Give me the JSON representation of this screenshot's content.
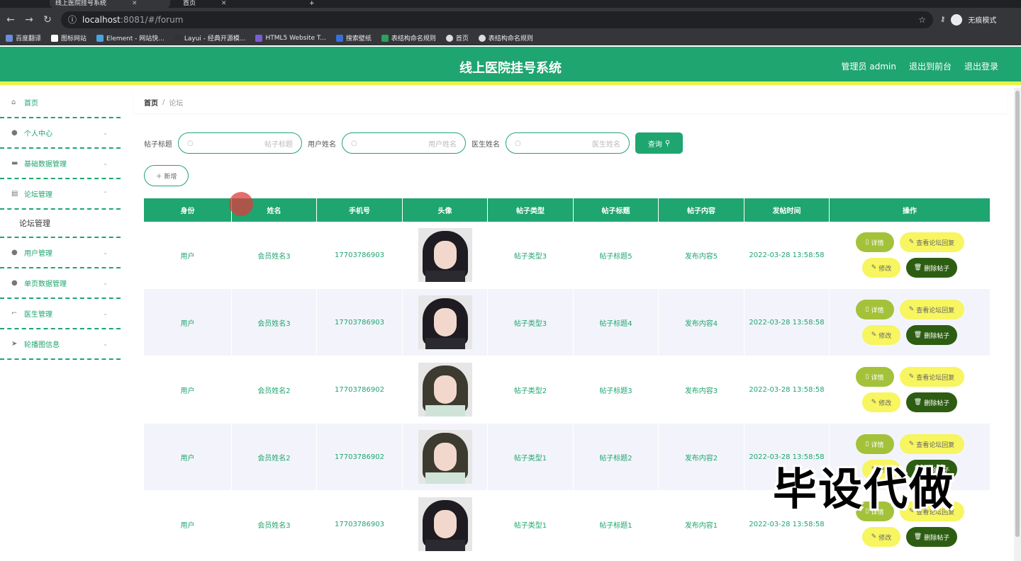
{
  "browser": {
    "tabs": [
      "线上医院挂号系统",
      "首页"
    ],
    "url_host": "localhost",
    "url_rest": ":8081/#/forum",
    "profile_label": "无痕模式",
    "bookmarks": [
      "百度翻译",
      "图标网站",
      "Element - 网站快...",
      "Layui - 经典开源模...",
      "HTML5 Website T...",
      "搜索壁纸",
      "表结构命名规则",
      "首页",
      "表结构命名规则"
    ]
  },
  "header": {
    "title": "线上医院挂号系统",
    "admin_label": "管理员 admin",
    "front_label": "退出到前台",
    "logout_label": "退出登录"
  },
  "sidebar": {
    "items": [
      {
        "label": "首页",
        "icon": "home-icon"
      },
      {
        "label": "个人中心",
        "icon": "user-icon"
      },
      {
        "label": "基础数据管理",
        "icon": "ticket-icon"
      },
      {
        "label": "论坛管理",
        "icon": "clipboard-icon"
      },
      {
        "label": "论坛管理",
        "icon": ""
      },
      {
        "label": "用户管理",
        "icon": "user-icon"
      },
      {
        "label": "单页数据管理",
        "icon": "bulb-icon"
      },
      {
        "label": "医生管理",
        "icon": "crop-icon"
      },
      {
        "label": "轮播图信息",
        "icon": "send-icon"
      }
    ]
  },
  "breadcrumb": {
    "home": "首页",
    "sep": "/",
    "current": "论坛"
  },
  "search": {
    "title_label": "帖子标题",
    "title_placeholder": "帖子标题",
    "user_label": "用户姓名",
    "user_placeholder": "用户姓名",
    "doctor_label": "医生姓名",
    "doctor_placeholder": "医生姓名",
    "query_label": "查询"
  },
  "add_label": "＋ 新增",
  "table": {
    "headers": [
      "身份",
      "姓名",
      "手机号",
      "头像",
      "帖子类型",
      "帖子标题",
      "帖子内容",
      "发帖时间",
      "操作"
    ],
    "rows": [
      {
        "role": "用户",
        "name": "会员姓名3",
        "phone": "17703786903",
        "type": "帖子类型3",
        "title": "帖子标题5",
        "content": "发布内容5",
        "time": "2022-03-28 13:58:58"
      },
      {
        "role": "用户",
        "name": "会员姓名3",
        "phone": "17703786903",
        "type": "帖子类型3",
        "title": "帖子标题4",
        "content": "发布内容4",
        "time": "2022-03-28 13:58:58"
      },
      {
        "role": "用户",
        "name": "会员姓名2",
        "phone": "17703786902",
        "type": "帖子类型2",
        "title": "帖子标题3",
        "content": "发布内容3",
        "time": "2022-03-28 13:58:58"
      },
      {
        "role": "用户",
        "name": "会员姓名2",
        "phone": "17703786902",
        "type": "帖子类型1",
        "title": "帖子标题2",
        "content": "发布内容2",
        "time": "2022-03-28 13:58:58"
      },
      {
        "role": "用户",
        "name": "会员姓名3",
        "phone": "17703786903",
        "type": "帖子类型1",
        "title": "帖子标题1",
        "content": "发布内容1",
        "time": "2022-03-28 13:58:58"
      }
    ],
    "ops": {
      "detail": "详情",
      "reply": "查看论坛回复",
      "edit": "修改",
      "delete": "删除帖子"
    }
  },
  "watermark": "毕设代做"
}
